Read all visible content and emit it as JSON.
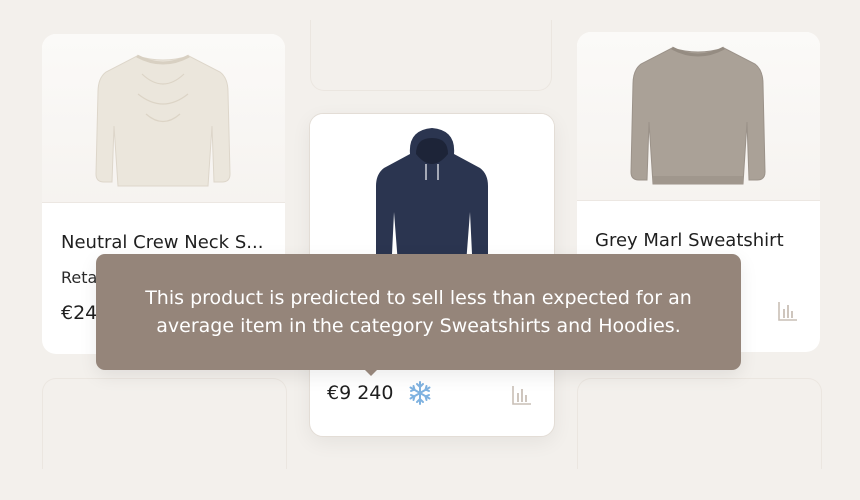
{
  "products": [
    {
      "title": "Neutral Crew Neck S...",
      "subtitle": "Reta",
      "price": "€24"
    },
    {
      "title": "",
      "price": "€9 240",
      "status_icon": "snowflake-icon",
      "status_color": "#7fb2e0"
    },
    {
      "title": "Grey Marl Sweatshirt"
    }
  ],
  "tooltip": {
    "text": "This product is predicted to sell less than expected for an average item in the category Sweatshirts and Hoodies."
  },
  "colors": {
    "background": "#f3f0ec",
    "tooltip": "#95857a",
    "hoodie": "#2b3550",
    "cream_sweater": "#ebe6dc",
    "grey_sweatshirt": "#aaa197"
  }
}
